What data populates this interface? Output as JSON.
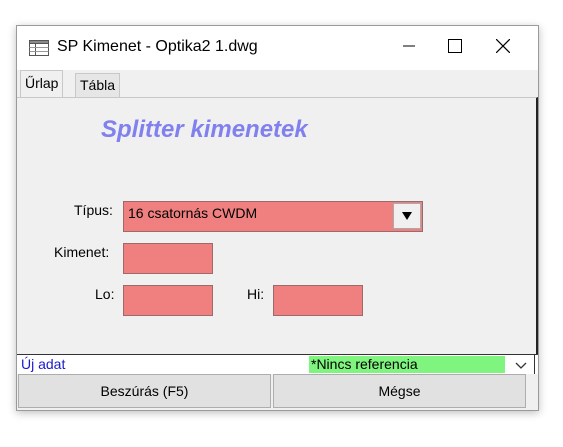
{
  "window": {
    "title": "SP Kimenet - Optika2 1.dwg",
    "icon": "form-grid-icon"
  },
  "titlebar_controls": [
    "minimize-icon",
    "maximize-icon",
    "close-icon"
  ],
  "tabs": [
    {
      "label": "Űrlap",
      "active": true
    },
    {
      "label": "Tábla",
      "active": false
    }
  ],
  "form": {
    "heading": "Splitter kimenetek",
    "field_color": "#f08080",
    "tipus": {
      "label": "Típus:",
      "value": "16 csatornás CWDM"
    },
    "kimenet": {
      "label": "Kimenet:",
      "value": ""
    },
    "lo": {
      "label": "Lo:",
      "value": ""
    },
    "hi": {
      "label": "Hi:",
      "value": ""
    }
  },
  "status": {
    "new_data": "Új adat",
    "reference": "*Nincs referencia",
    "reference_color": "#7ff57f"
  },
  "buttons": {
    "insert": "Beszúrás (F5)",
    "cancel": "Mégse"
  }
}
